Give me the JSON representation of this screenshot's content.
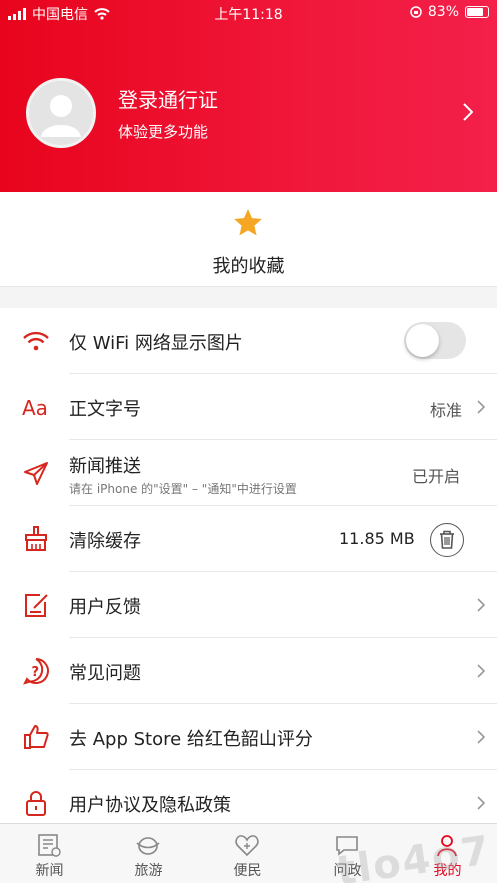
{
  "status_bar": {
    "carrier": "中国电信",
    "time": "上午11:18",
    "battery": "83%"
  },
  "profile": {
    "title": "登录通行证",
    "subtitle": "体验更多功能"
  },
  "favorites": {
    "label": "我的收藏"
  },
  "settings": [
    {
      "title": "仅 WiFi 网络显示图片",
      "icon": "wifi-icon",
      "toggle_on": false
    },
    {
      "title": "正文字号",
      "icon": "font-size-icon",
      "value": "标准"
    },
    {
      "title": "新闻推送",
      "icon": "paper-plane-icon",
      "subtitle": "请在 iPhone 的\"设置\" – \"通知\"中进行设置",
      "value": "已开启"
    },
    {
      "title": "清除缓存",
      "icon": "broom-icon",
      "value": "11.85 MB"
    },
    {
      "title": "用户反馈",
      "icon": "feedback-icon"
    },
    {
      "title": "常见问题",
      "icon": "question-icon"
    },
    {
      "title": "去 App Store 给红色韶山评分",
      "icon": "thumbs-up-icon"
    },
    {
      "title": "用户协议及隐私政策",
      "icon": "lock-icon"
    }
  ],
  "tabs": [
    {
      "label": "新闻",
      "icon": "news-icon"
    },
    {
      "label": "旅游",
      "icon": "travel-icon"
    },
    {
      "label": "便民",
      "icon": "heart-plus-icon"
    },
    {
      "label": "问政",
      "icon": "chat-icon"
    },
    {
      "label": "我的",
      "icon": "person-icon",
      "active": true
    }
  ],
  "colors": {
    "accent": "#e8041c",
    "star": "#f5a623"
  }
}
